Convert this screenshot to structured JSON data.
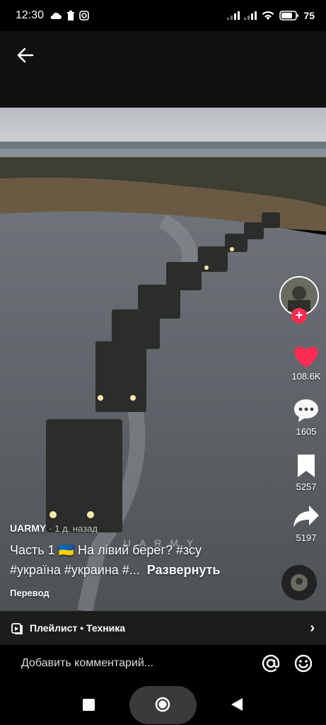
{
  "status": {
    "time": "12:30",
    "battery": "75"
  },
  "video": {
    "watermark": "UARMY"
  },
  "actions": {
    "likes": "108.6K",
    "comments": "1605",
    "saves": "5257",
    "shares": "5197"
  },
  "caption": {
    "author": "UARMY",
    "ago": "· 1 д. назад",
    "line1": "Часть 1 🇺🇦 На лівий берег? #зсу",
    "line2": "#україна #украина #...",
    "expand": "Развернуть",
    "translate": "Перевод"
  },
  "playlist": {
    "label": "Плейлист • Техника"
  },
  "comment": {
    "placeholder": "Добавить комментарий..."
  },
  "colors": {
    "like": "#fe2c55",
    "follow": "#fe2c55"
  }
}
